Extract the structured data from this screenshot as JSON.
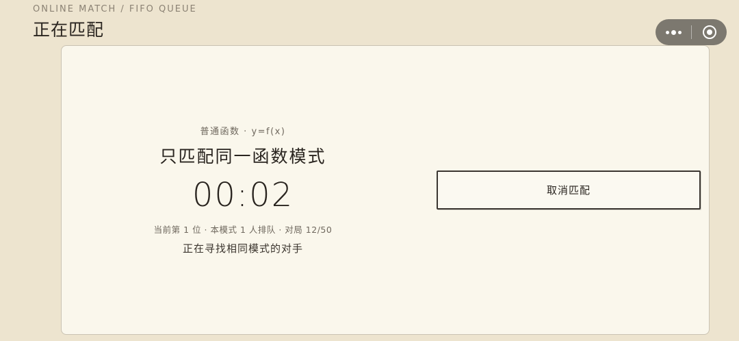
{
  "header": {
    "eyebrow": "ONLINE MATCH / FIFO QUEUE",
    "title": "正在匹配"
  },
  "capsule": {
    "more_icon": "more-dots-icon",
    "close_icon": "target-close-icon"
  },
  "match": {
    "mode_subtitle": "普通函数 · y=f(x)",
    "mode_title": "只匹配同一函数模式",
    "timer": "00:02",
    "queue_info": "当前第 1 位 · 本模式 1 人排队 · 对局 12/50",
    "status": "正在寻找相同模式的对手"
  },
  "actions": {
    "cancel_label": "取消匹配"
  },
  "colors": {
    "background": "#ede4cf",
    "card": "#faf7ec",
    "capsule": "#7c786f",
    "text": "#29241f"
  }
}
